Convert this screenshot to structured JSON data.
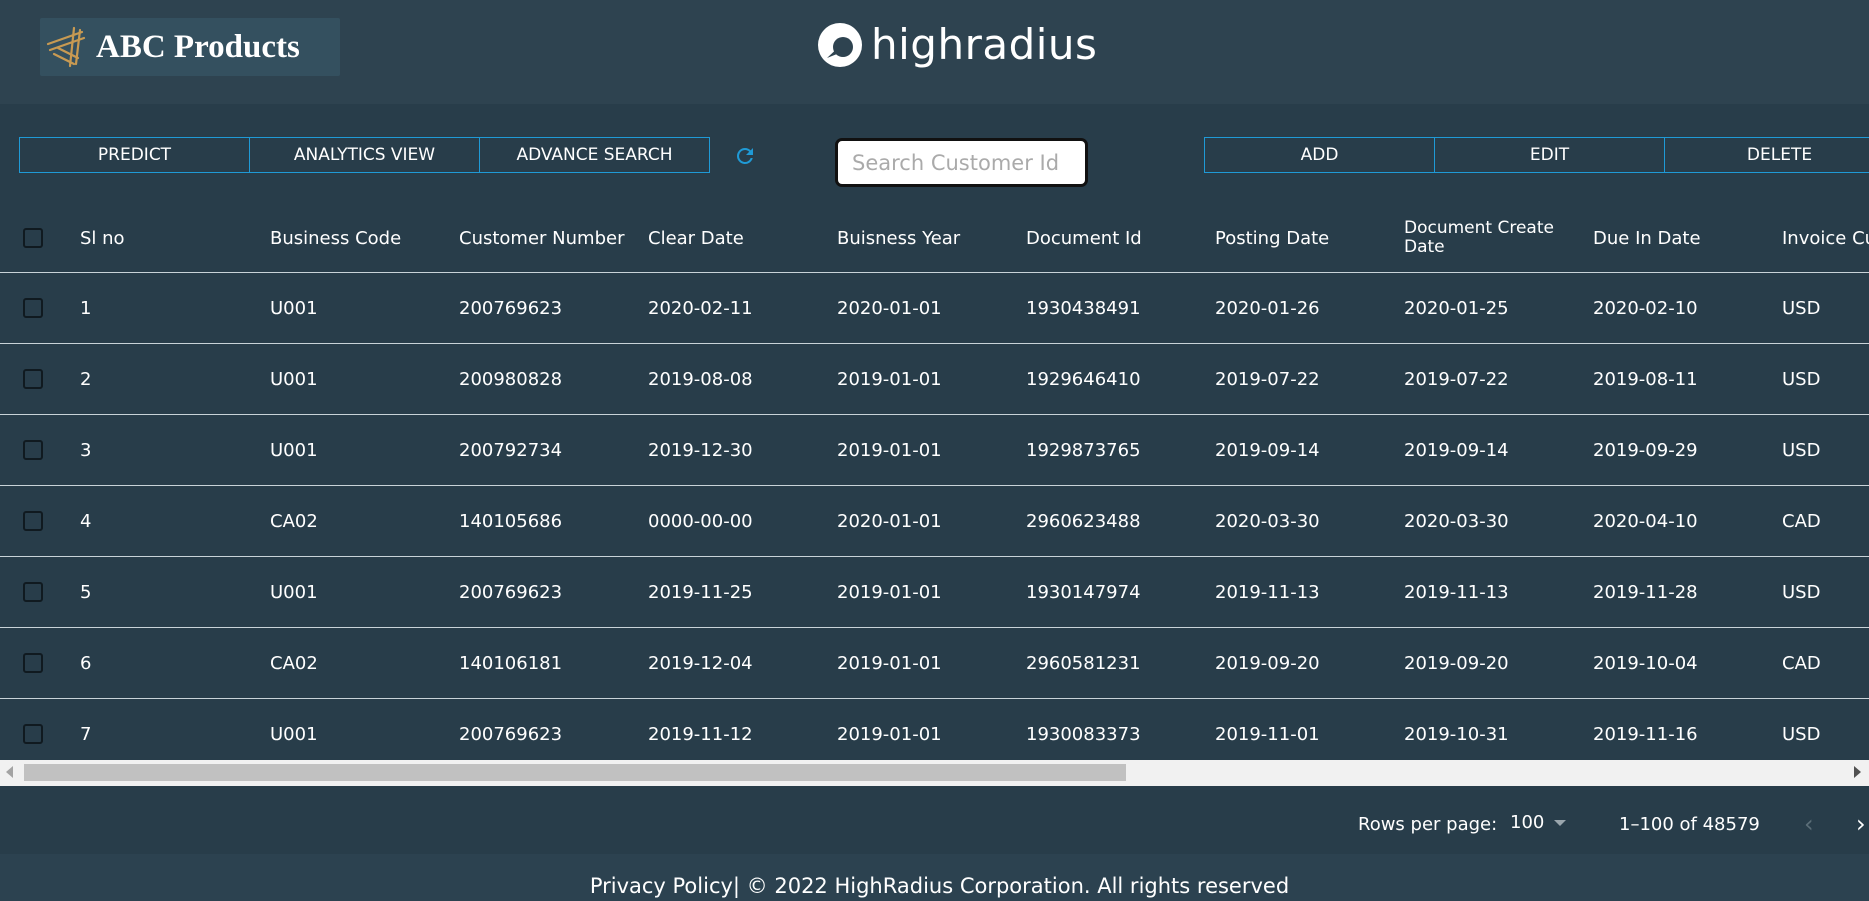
{
  "header": {
    "brand_name": "ABC Products",
    "logo_text": "highradius"
  },
  "toolbar": {
    "left_buttons": [
      "PREDICT",
      "ANALYTICS VIEW",
      "ADVANCE SEARCH"
    ],
    "search_placeholder": "Search Customer Id",
    "right_buttons": [
      "ADD",
      "EDIT",
      "DELETE"
    ]
  },
  "table": {
    "columns": [
      "Sl no",
      "Business Code",
      "Customer Number",
      "Clear Date",
      "Buisness Year",
      "Document Id",
      "Posting Date",
      "Document Create Date",
      "Due In Date",
      "Invoice Cu"
    ],
    "rows": [
      [
        "1",
        "U001",
        "200769623",
        "2020-02-11",
        "2020-01-01",
        "1930438491",
        "2020-01-26",
        "2020-01-25",
        "2020-02-10",
        "USD"
      ],
      [
        "2",
        "U001",
        "200980828",
        "2019-08-08",
        "2019-01-01",
        "1929646410",
        "2019-07-22",
        "2019-07-22",
        "2019-08-11",
        "USD"
      ],
      [
        "3",
        "U001",
        "200792734",
        "2019-12-30",
        "2019-01-01",
        "1929873765",
        "2019-09-14",
        "2019-09-14",
        "2019-09-29",
        "USD"
      ],
      [
        "4",
        "CA02",
        "140105686",
        "0000-00-00",
        "2020-01-01",
        "2960623488",
        "2020-03-30",
        "2020-03-30",
        "2020-04-10",
        "CAD"
      ],
      [
        "5",
        "U001",
        "200769623",
        "2019-11-25",
        "2019-01-01",
        "1930147974",
        "2019-11-13",
        "2019-11-13",
        "2019-11-28",
        "USD"
      ],
      [
        "6",
        "CA02",
        "140106181",
        "2019-12-04",
        "2019-01-01",
        "2960581231",
        "2019-09-20",
        "2019-09-20",
        "2019-10-04",
        "CAD"
      ],
      [
        "7",
        "U001",
        "200769623",
        "2019-11-12",
        "2019-01-01",
        "1930083373",
        "2019-11-01",
        "2019-10-31",
        "2019-11-16",
        "USD"
      ]
    ]
  },
  "pagination": {
    "rows_per_page_label": "Rows per page:",
    "rows_per_page_value": "100",
    "range_text": "1–100 of 48579"
  },
  "footer": {
    "text": "Privacy Policy| © 2022 HighRadius Corporation. All rights reserved"
  },
  "colors": {
    "accent": "#1f9ad6",
    "background": "#2c4250",
    "panel": "#283d4a"
  }
}
